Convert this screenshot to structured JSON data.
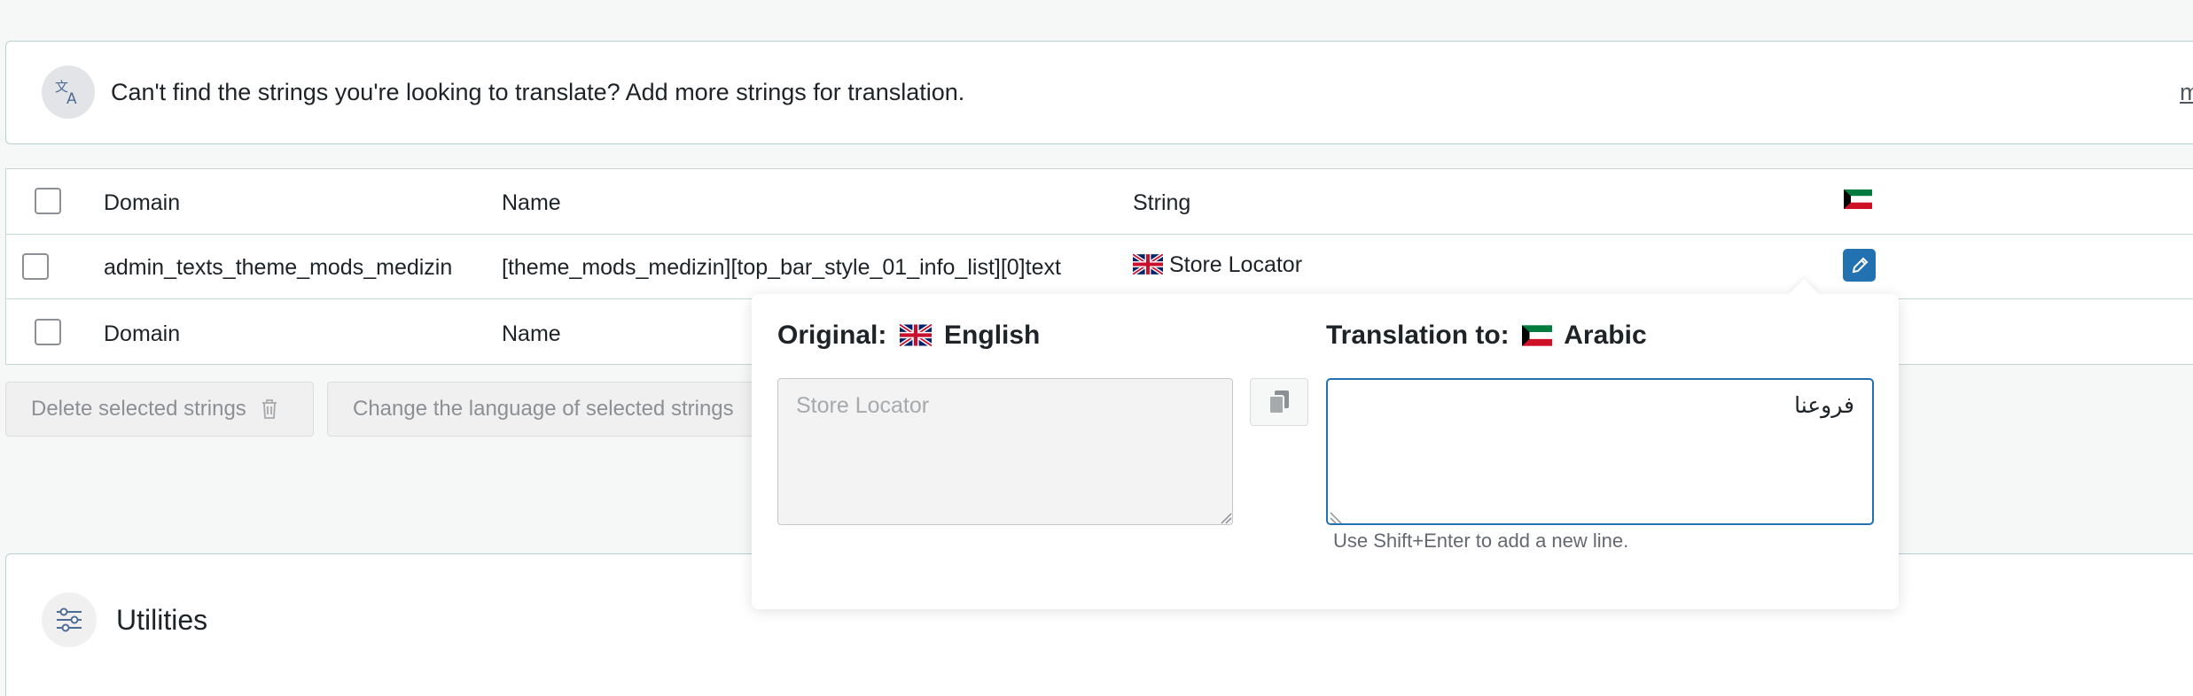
{
  "notice": {
    "icon": "translate-icon",
    "text": "Can't find the strings you're looking to translate? Add more strings for translation.",
    "more_link": "m"
  },
  "table": {
    "header": {
      "domain": "Domain",
      "name": "Name",
      "string": "String"
    },
    "rows": [
      {
        "domain": "admin_texts_theme_mods_medizin",
        "name": "[theme_mods_medizin][top_bar_style_01_info_list][0]text",
        "string": "Store Locator"
      }
    ],
    "footer": {
      "domain": "Domain",
      "name": "Name"
    }
  },
  "actions": {
    "delete_label": "Delete selected strings",
    "change_language_label": "Change the language of selected strings"
  },
  "utilities": {
    "title": "Utilities"
  },
  "popup": {
    "original_label": "Original:",
    "original_language": "English",
    "translation_label": "Translation to:",
    "translation_language": "Arabic",
    "original_value": "Store Locator",
    "translation_value": "فروعنا",
    "hint": "Use Shift+Enter to add a new line."
  },
  "colors": {
    "accent": "#2271b1",
    "border": "#c3d9d6",
    "muted_text": "#8c8f94"
  }
}
